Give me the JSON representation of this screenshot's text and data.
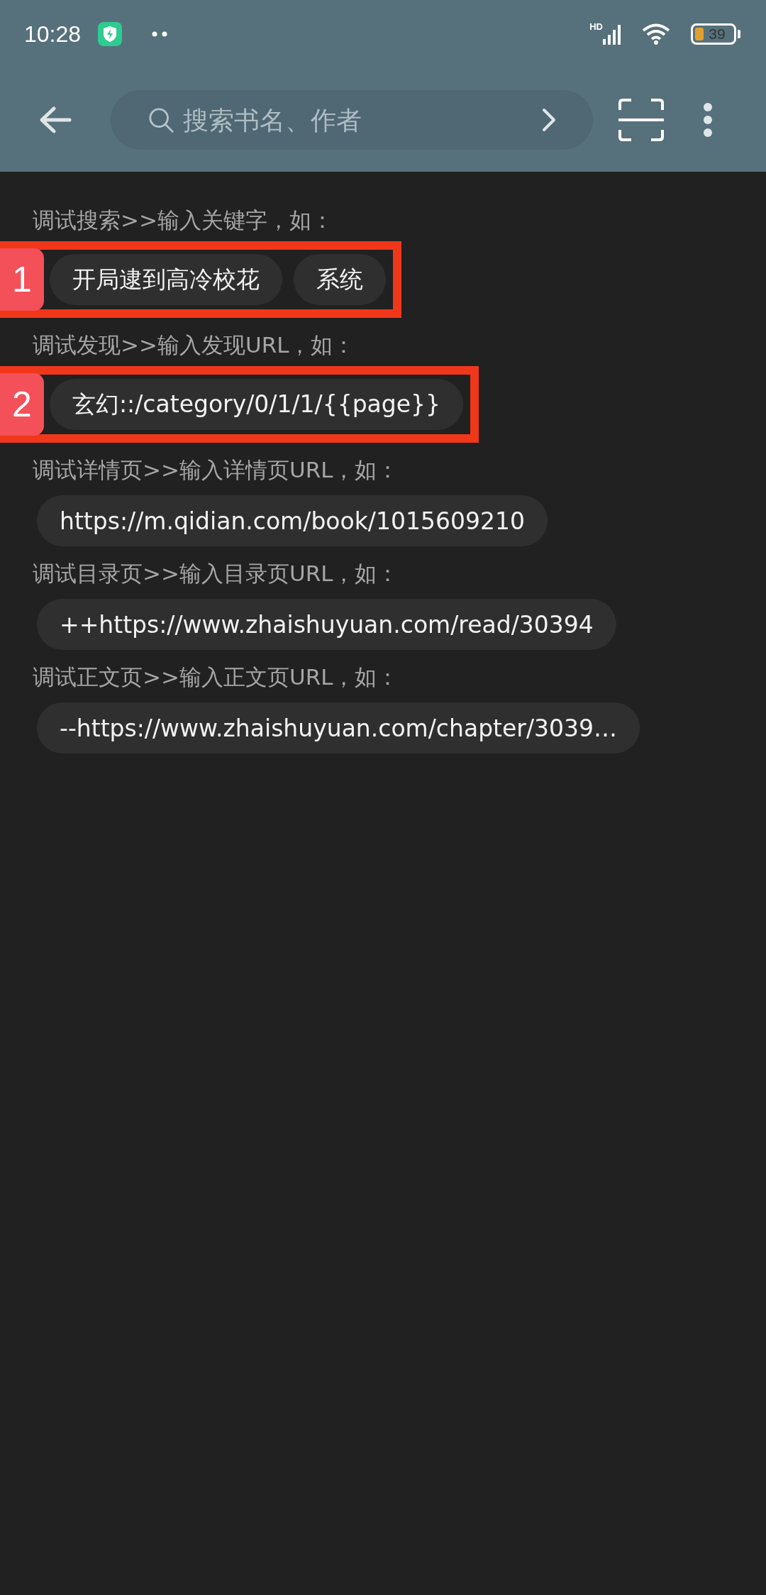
{
  "status_bar": {
    "time": "10:28",
    "signal_label": "HD",
    "battery": "39"
  },
  "search": {
    "placeholder": "搜索书名、作者"
  },
  "sections": [
    {
      "label": "调试搜索>>输入关键字，如：",
      "chips": [
        "开局逮到高冷校花",
        "系统"
      ]
    },
    {
      "label": "调试发现>>输入发现URL，如：",
      "chips": [
        "玄幻::/category/0/1/1/{{page}}"
      ]
    },
    {
      "label": "调试详情页>>输入详情页URL，如：",
      "chips": [
        "https://m.qidian.com/book/1015609210"
      ]
    },
    {
      "label": "调试目录页>>输入目录页URL，如：",
      "chips": [
        "++https://www.zhaishuyuan.com/read/30394"
      ]
    },
    {
      "label": "调试正文页>>输入正文页URL，如：",
      "chips": [
        "--https://www.zhaishuyuan.com/chapter/3039…"
      ]
    }
  ],
  "annotations": [
    {
      "number": "1"
    },
    {
      "number": "2"
    }
  ]
}
